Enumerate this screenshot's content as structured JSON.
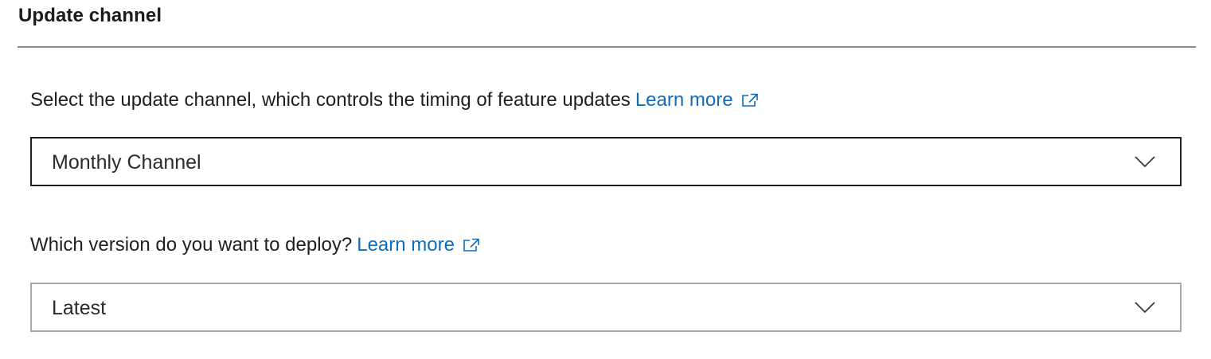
{
  "section": {
    "title": "Update channel"
  },
  "update_channel": {
    "label": "Select the update channel, which controls the timing of feature updates",
    "learn_more": "Learn more",
    "selected_value": "Monthly Channel"
  },
  "version": {
    "label": "Which version do you want to deploy?",
    "learn_more": "Learn more",
    "selected_value": "Latest"
  },
  "icons": {
    "external_link": "external-link-icon",
    "dropdown": "chevron-down-icon"
  },
  "colors": {
    "link": "#0f6cbd",
    "focused_border": "#1f1f1f",
    "default_border": "#a8a8a8",
    "divider": "#8a8a8a"
  }
}
